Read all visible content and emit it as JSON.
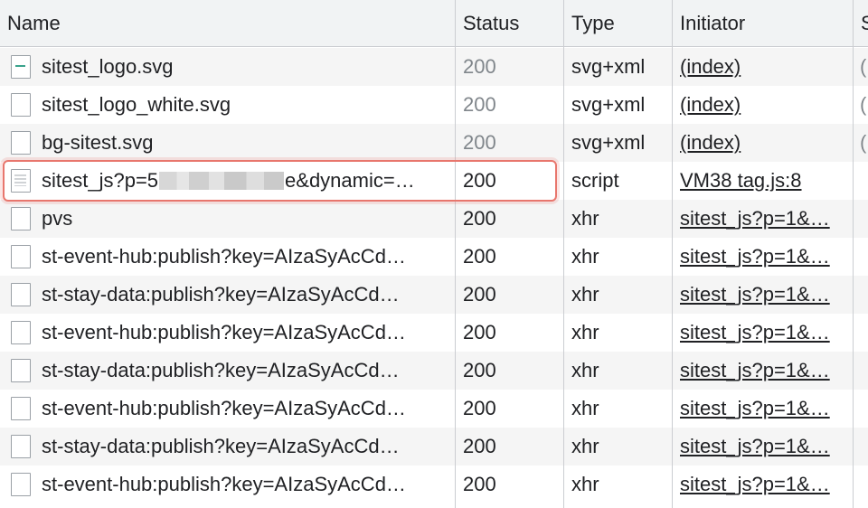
{
  "columns": {
    "name": "Name",
    "status": "Status",
    "type": "Type",
    "initiator": "Initiator",
    "size": "S"
  },
  "rows": [
    {
      "name": "sitest_logo.svg",
      "status": "200",
      "type": "svg+xml",
      "initiator": "(index)",
      "size": "(",
      "cached": true,
      "icon": "image-file-icon"
    },
    {
      "name": "sitest_logo_white.svg",
      "status": "200",
      "type": "svg+xml",
      "initiator": "(index)",
      "size": "(",
      "cached": true,
      "icon": "file-icon"
    },
    {
      "name": "bg-sitest.svg",
      "status": "200",
      "type": "svg+xml",
      "initiator": "(index)",
      "size": "(",
      "cached": true,
      "icon": "file-icon"
    },
    {
      "name_prefix": "sitest_js?p=5",
      "name_suffix": "e&dynamic=…",
      "status": "200",
      "type": "script",
      "initiator": "VM38 tag.js:8",
      "size": "",
      "cached": false,
      "icon": "script-file-icon",
      "highlighted": true
    },
    {
      "name": "pvs",
      "status": "200",
      "type": "xhr",
      "initiator": "sitest_js?p=1&…",
      "size": "",
      "cached": false,
      "icon": "file-icon"
    },
    {
      "name": "st-event-hub:publish?key=AIzaSyAcCd…",
      "status": "200",
      "type": "xhr",
      "initiator": "sitest_js?p=1&…",
      "size": "",
      "cached": false,
      "icon": "file-icon"
    },
    {
      "name": "st-stay-data:publish?key=AIzaSyAcCd…",
      "status": "200",
      "type": "xhr",
      "initiator": "sitest_js?p=1&…",
      "size": "",
      "cached": false,
      "icon": "file-icon"
    },
    {
      "name": "st-event-hub:publish?key=AIzaSyAcCd…",
      "status": "200",
      "type": "xhr",
      "initiator": "sitest_js?p=1&…",
      "size": "",
      "cached": false,
      "icon": "file-icon"
    },
    {
      "name": "st-stay-data:publish?key=AIzaSyAcCd…",
      "status": "200",
      "type": "xhr",
      "initiator": "sitest_js?p=1&…",
      "size": "",
      "cached": false,
      "icon": "file-icon"
    },
    {
      "name": "st-event-hub:publish?key=AIzaSyAcCd…",
      "status": "200",
      "type": "xhr",
      "initiator": "sitest_js?p=1&…",
      "size": "",
      "cached": false,
      "icon": "file-icon"
    },
    {
      "name": "st-stay-data:publish?key=AIzaSyAcCd…",
      "status": "200",
      "type": "xhr",
      "initiator": "sitest_js?p=1&…",
      "size": "",
      "cached": false,
      "icon": "file-icon"
    },
    {
      "name": "st-event-hub:publish?key=AIzaSyAcCd…",
      "status": "200",
      "type": "xhr",
      "initiator": "sitest_js?p=1&…",
      "size": "",
      "cached": false,
      "icon": "file-icon"
    }
  ],
  "colors": {
    "highlight": "#e8766d",
    "cached_status": "#80868b",
    "row_alt": "#f5f5f5"
  }
}
